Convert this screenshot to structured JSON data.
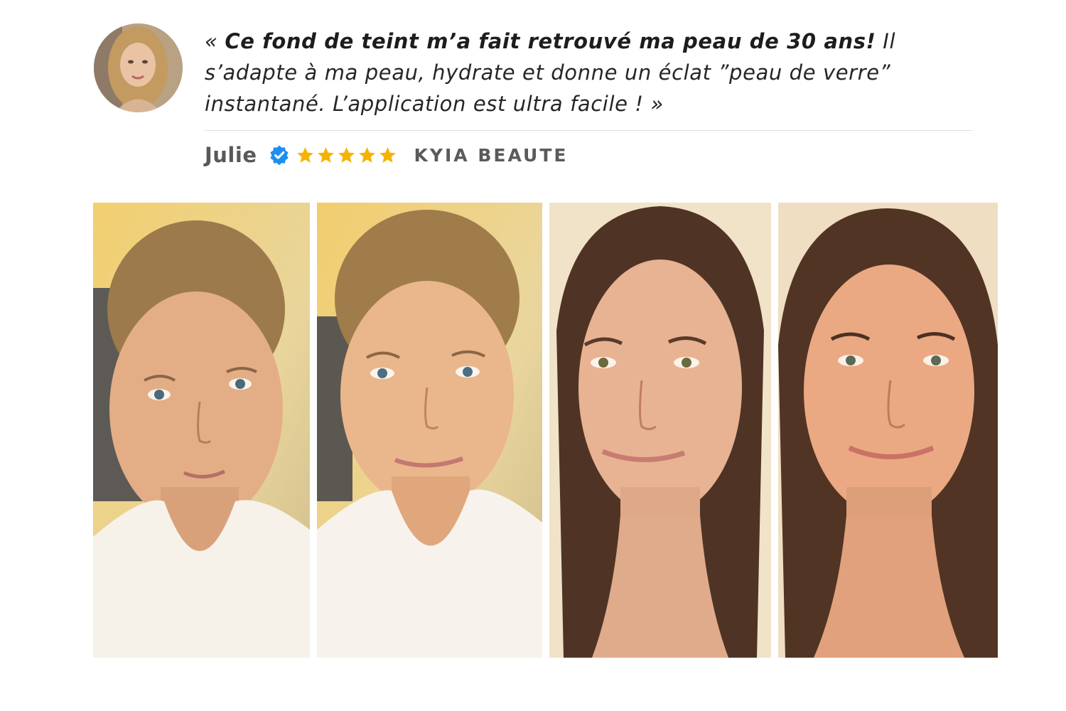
{
  "review": {
    "quote_open": "« ",
    "quote_bold": "Ce fond de teint m’a fait retrouvé ma peau de 30 ans!",
    "quote_rest": " Il s’adapte à ma peau, hydrate et donne un éclat ”peau de verre” instantané. L’application est ultra facile ! »",
    "author": "Julie",
    "verified_icon": "verified-badge-icon",
    "rating": 5,
    "rating_max": 5,
    "brand": "KYIA BEAUTE"
  },
  "colors": {
    "star": "#f5b301",
    "verified": "#1d8ff0",
    "quote_text": "#262626",
    "meta_text": "#5a5a5a"
  },
  "photos": [
    {
      "subject": "blonde-woman-before",
      "icon": "portrait-photo"
    },
    {
      "subject": "blonde-woman-after",
      "icon": "portrait-photo"
    },
    {
      "subject": "brunette-woman-before",
      "icon": "portrait-photo"
    },
    {
      "subject": "brunette-woman-after",
      "icon": "portrait-photo"
    }
  ]
}
